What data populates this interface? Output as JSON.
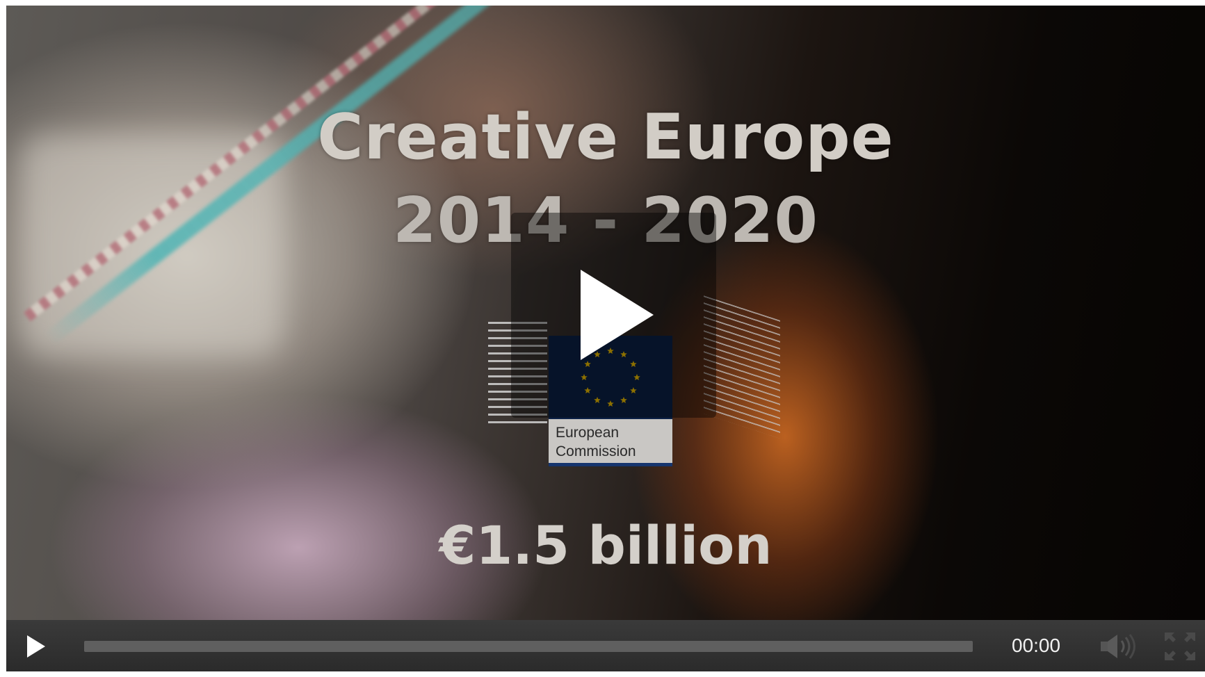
{
  "video": {
    "title_line_1": "Creative Europe",
    "title_line_2": "2014 - 2020",
    "amount": "€1.5 billion",
    "logo_text_line_1": "European",
    "logo_text_line_2": "Commission"
  },
  "controls": {
    "time": "00:00",
    "progress_fraction": 0
  },
  "icons": {
    "big_play": "play-icon",
    "play": "play-icon",
    "volume": "volume-icon",
    "fullscreen": "fullscreen-icon"
  },
  "colors": {
    "control_bar": "#2b2b2b",
    "progress_track": "#5f5f5f",
    "eu_blue": "#0c2147",
    "eu_star": "#f2c100"
  }
}
